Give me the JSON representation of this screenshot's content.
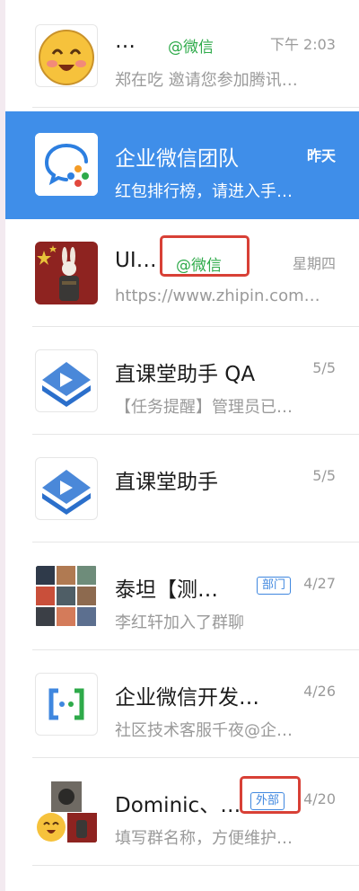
{
  "conversations": [
    {
      "name": "…",
      "tag": "@微信",
      "time": "下午 2:03",
      "preview": "郑在吃 邀请您参加腾讯…",
      "avatar": "emoji-face-icon"
    },
    {
      "name": "企业微信团队",
      "time": "昨天",
      "preview": "红包排行榜，请进入手…",
      "avatar": "wecom-logo-icon",
      "active": true
    },
    {
      "name": "UI…",
      "tag": "@微信",
      "time": "星期四",
      "preview": "https://www.zhipin.com…",
      "avatar": "rabbit-photo-icon"
    },
    {
      "name": "直课堂助手 QA",
      "time": "5/5",
      "preview": "【任务提醒】管理员已…",
      "avatar": "book-play-icon"
    },
    {
      "name": "直课堂助手",
      "time": "5/5",
      "preview": "",
      "avatar": "book-play-icon"
    },
    {
      "name": "泰坦【测…",
      "badge": "部门",
      "time": "4/27",
      "preview": "李红轩加入了群聊",
      "avatar": "group-grid-icon"
    },
    {
      "name": "企业微信开发…",
      "time": "4/26",
      "preview": "社区技术客服千夜@企…",
      "avatar": "dev-brackets-icon"
    },
    {
      "name": "Dominic、…",
      "badge": "外部",
      "time": "4/20",
      "preview": "填写群名称，方便维护…",
      "avatar": "group-mixed-icon"
    }
  ],
  "colors": {
    "active": "#3f8ee9",
    "green_tag": "#2eaa4a",
    "badge_blue": "#3f87df",
    "highlight_red": "#d84036"
  }
}
